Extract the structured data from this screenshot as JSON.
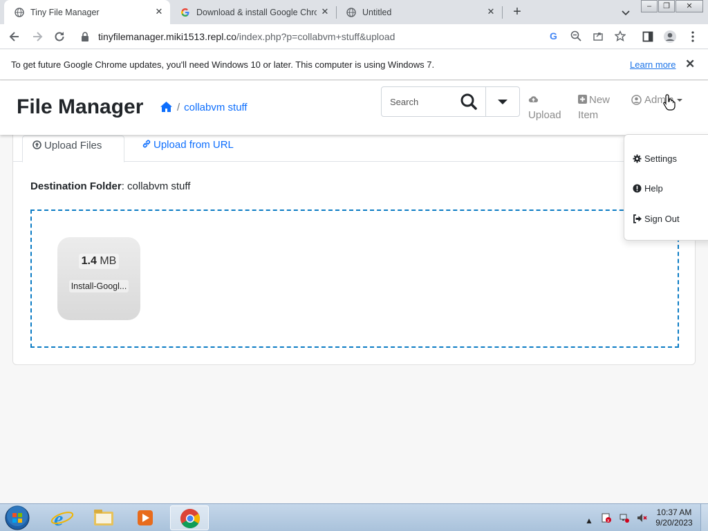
{
  "browser": {
    "tabs": [
      {
        "title": "Tiny File Manager",
        "active": true
      },
      {
        "title": "Download & install Google Chrome",
        "active": false
      },
      {
        "title": "Untitled",
        "active": false
      }
    ],
    "new_tab_symbol": "+",
    "url_host": "tinyfilemanager.miki1513.repl.co",
    "url_path": "/index.php?p=collabvm+stuff&upload"
  },
  "infobar": {
    "message": "To get future Google Chrome updates, you'll need Windows 10 or later. This computer is using Windows 7.",
    "learn_more": "Learn more"
  },
  "app": {
    "brand": "File Manager",
    "breadcrumb_separator": "/",
    "breadcrumb_folder": "collabvm stuff",
    "search_placeholder": "Search",
    "nav": {
      "upload_line1": "Upload",
      "new_item_line1": "New",
      "new_item_line2": "Item",
      "admin": "Admin"
    },
    "upload_tabs": {
      "files": "Upload Files",
      "url": "Upload from URL"
    },
    "destination_label": "Destination Folder",
    "destination_value": ": collabvm stuff",
    "file": {
      "size_value": "1.4",
      "size_unit": "MB",
      "name": "Install-Googl..."
    },
    "dropdown": {
      "settings": "Settings",
      "help": "Help",
      "sign_out": "Sign Out"
    }
  },
  "taskbar": {
    "time": "10:37 AM",
    "date": "9/20/2023"
  },
  "colors": {
    "link_blue": "#0d6efd",
    "dropzone_border": "#0a7bc4",
    "chrome_tabstrip": "#dee1e6"
  }
}
